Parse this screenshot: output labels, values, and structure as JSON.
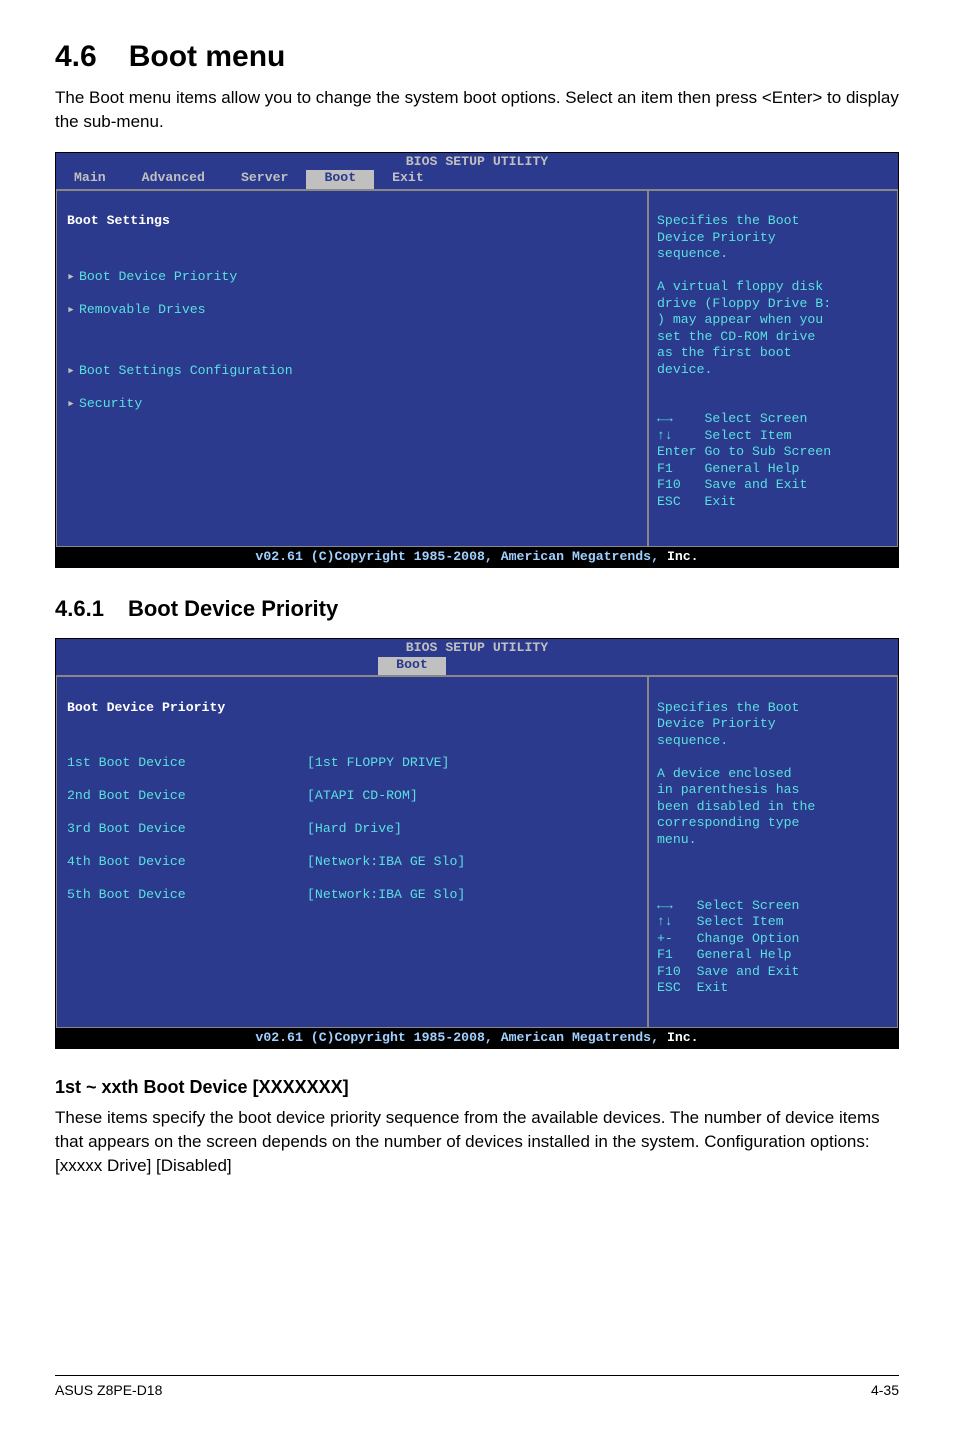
{
  "section": {
    "number": "4.6",
    "title": "Boot menu"
  },
  "intro": "The Boot menu items allow you to change the system boot options. Select an item then press <Enter> to display the sub-menu.",
  "bios1": {
    "setup_title": "BIOS SETUP UTILITY",
    "tabs": {
      "main": "Main",
      "advanced": "Advanced",
      "server": "Server",
      "boot": "Boot",
      "exit": "Exit"
    },
    "left": {
      "heading": "Boot Settings",
      "items": [
        "Boot Device Priority",
        "Removable Drives",
        "Boot Settings Configuration",
        "Security"
      ]
    },
    "right": {
      "help": "Specifies the Boot\nDevice Priority\nsequence.\n\nA virtual floppy disk\ndrive (Floppy Drive B:\n) may appear when you\nset the CD-ROM drive\nas the first boot\ndevice.",
      "keys": [
        {
          "k": "←→ ",
          "d": "Select Screen"
        },
        {
          "k": "↑↓ ",
          "d": "Select Item"
        },
        {
          "k": "Enter",
          "d": "Go to Sub Screen"
        },
        {
          "k": "F1 ",
          "d": "General Help"
        },
        {
          "k": "F10",
          "d": "Save and Exit"
        },
        {
          "k": "ESC",
          "d": "Exit"
        }
      ]
    },
    "footer_pre": "v02.61 (C)Copyright 1985-2008, American Megatrends, ",
    "footer_hi": "Inc."
  },
  "subsection": {
    "number": "4.6.1",
    "title": "Boot Device Priority"
  },
  "bios2": {
    "setup_title": "BIOS SETUP UTILITY",
    "tab_boot": "Boot",
    "left": {
      "heading": "Boot Device Priority",
      "rows": [
        {
          "label": "1st Boot Device",
          "value": "[1st FLOPPY DRIVE]"
        },
        {
          "label": "2nd Boot Device",
          "value": "[ATAPI CD-ROM]"
        },
        {
          "label": "3rd Boot Device",
          "value": "[Hard Drive]"
        },
        {
          "label": "4th Boot Device",
          "value": "[Network:IBA GE Slo]"
        },
        {
          "label": "5th Boot Device",
          "value": "[Network:IBA GE Slo]"
        }
      ]
    },
    "right": {
      "help": "Specifies the Boot\nDevice Priority\nsequence.\n\nA device enclosed\nin parenthesis has\nbeen disabled in the\ncorresponding type\nmenu.",
      "keys": [
        {
          "k": "←→ ",
          "d": "Select Screen"
        },
        {
          "k": "↑↓ ",
          "d": "Select Item"
        },
        {
          "k": "+- ",
          "d": "Change Option"
        },
        {
          "k": "F1 ",
          "d": "General Help"
        },
        {
          "k": "F10",
          "d": "Save and Exit"
        },
        {
          "k": "ESC",
          "d": "Exit"
        }
      ]
    },
    "footer_pre": "v02.61 (C)Copyright 1985-2008, American Megatrends, ",
    "footer_hi": "Inc."
  },
  "sub_heading": "1st ~ xxth Boot Device [XXXXXXX]",
  "sub_body": "These items specify the boot device priority sequence from the available devices. The number of device items that appears on the screen depends on the number of devices installed in the system. Configuration options: [xxxxx Drive] [Disabled]",
  "footer": {
    "left": "ASUS Z8PE-D18",
    "right": "4-35"
  }
}
